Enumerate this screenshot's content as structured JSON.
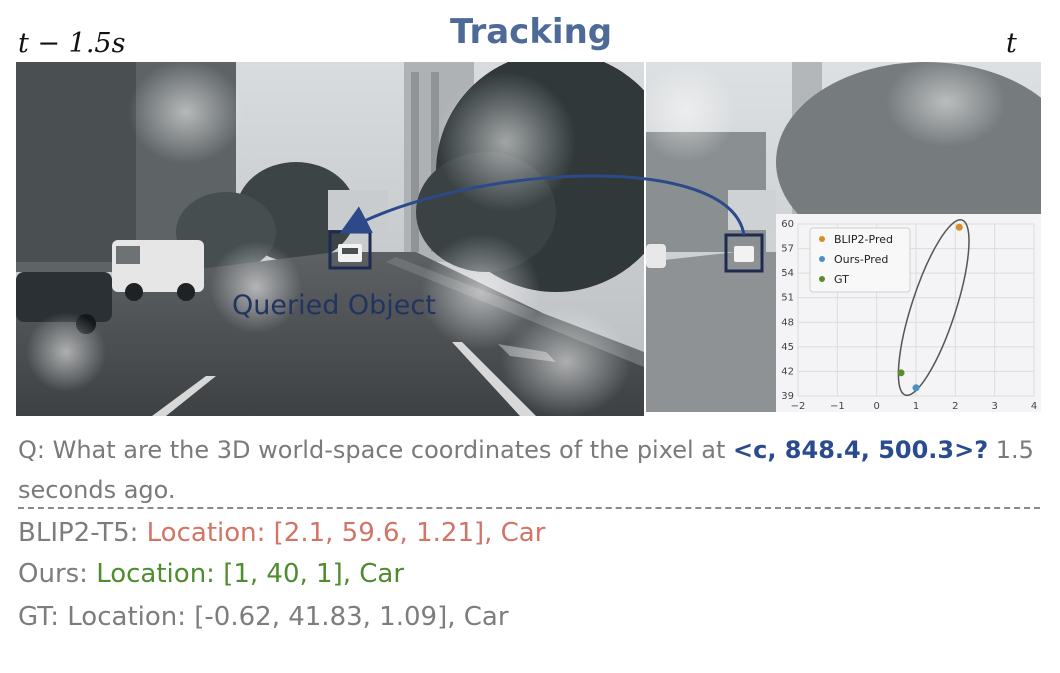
{
  "header": {
    "time_left": "t − 1.5s",
    "title": "Tracking",
    "time_right": "t"
  },
  "scene": {
    "left_image_label": "Queried Object"
  },
  "plot": {
    "y_ticks": [
      "60",
      "57",
      "54",
      "51",
      "48",
      "45",
      "42",
      "39"
    ],
    "x_ticks": [
      "−2",
      "−1",
      "0",
      "1",
      "2",
      "3",
      "4"
    ],
    "legend": [
      {
        "label": "BLIP2-Pred",
        "color": "#d58e2a"
      },
      {
        "label": "Ours-Pred",
        "color": "#4a90c6"
      },
      {
        "label": "GT",
        "color": "#5a8c2a"
      }
    ],
    "points": [
      {
        "name": "BLIP2-Pred",
        "x": 2.1,
        "y": 59.6,
        "color": "#d58e2a"
      },
      {
        "name": "Ours-Pred",
        "x": 1,
        "y": 40,
        "color": "#4a90c6"
      },
      {
        "name": "GT",
        "x": 0.62,
        "y": 41.83,
        "color": "#5a8c2a"
      }
    ],
    "xlim": [
      -2,
      4
    ],
    "ylim": [
      39,
      60
    ]
  },
  "question": {
    "prefix": "Q: What are the 3D world-space coordinates of the pixel at ",
    "highlight": "<c, 848.4, 500.3>?",
    "suffix": " 1.5 seconds ago."
  },
  "answers": {
    "blip2_label": "BLIP2-T5: ",
    "blip2_value": "Location: [2.1, 59.6, 1.21], Car",
    "ours_label": "Ours: ",
    "ours_value": "Location: [1, 40, 1], Car",
    "gt_label": "GT: ",
    "gt_value": "Location: [-0.62, 41.83, 1.09], Car"
  }
}
